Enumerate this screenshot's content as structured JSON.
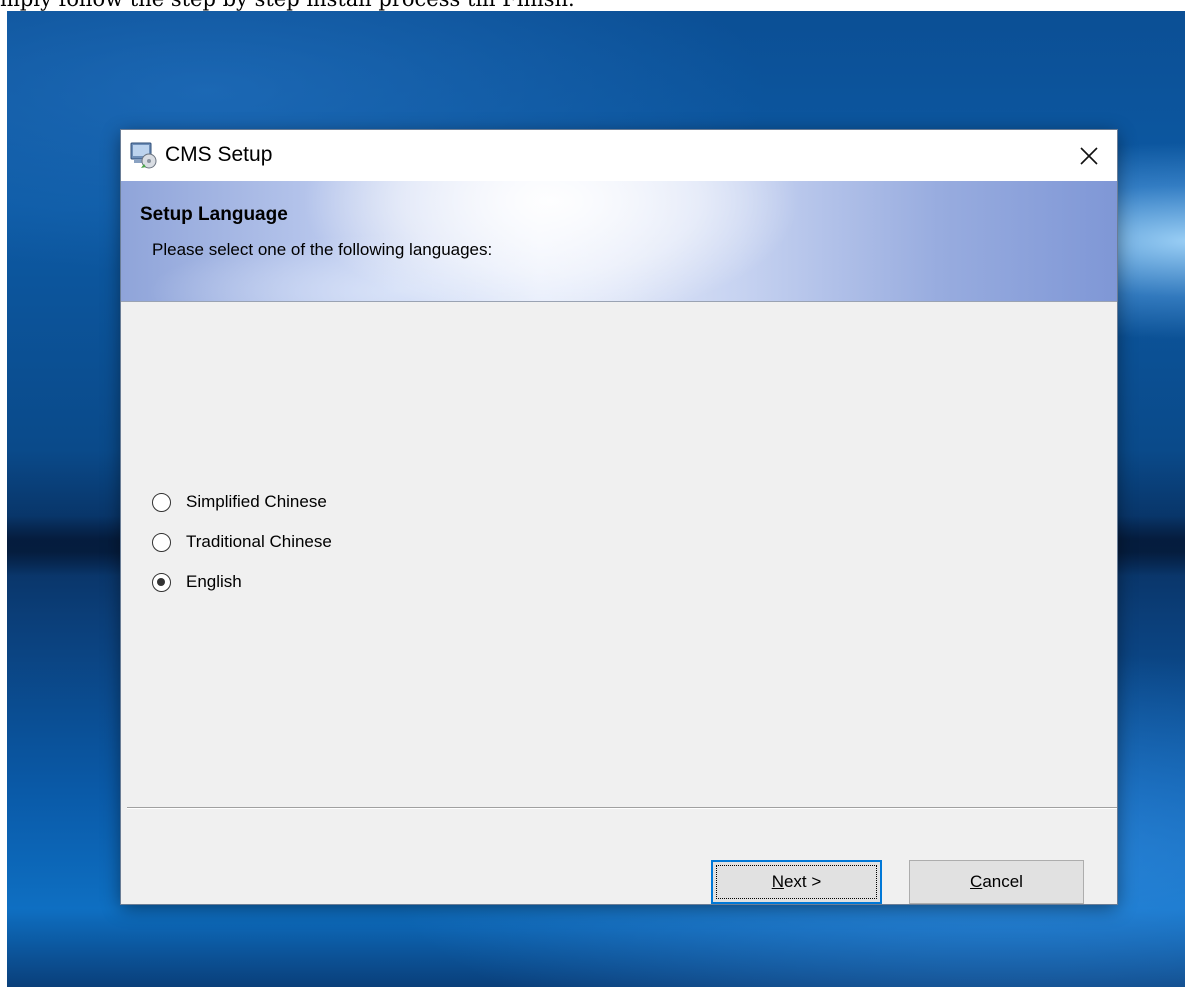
{
  "caption": {
    "text": "mply follow the step by step install process till Finish."
  },
  "window": {
    "title": "CMS Setup",
    "close_icon": "close-icon",
    "app_icon": "setup-installer-icon"
  },
  "header": {
    "title": "Setup Language",
    "subtitle": "Please select one of the following languages:"
  },
  "languages": {
    "options": [
      {
        "label": "Simplified Chinese",
        "selected": false
      },
      {
        "label": "Traditional Chinese",
        "selected": false
      },
      {
        "label": "English",
        "selected": true
      }
    ]
  },
  "buttons": {
    "next": {
      "mnemonic": "N",
      "rest": "ext >"
    },
    "cancel": {
      "mnemonic": "C",
      "rest": "ancel"
    }
  },
  "colors": {
    "focus_border": "#0078d7",
    "dialog_bg": "#f0f0f0"
  }
}
